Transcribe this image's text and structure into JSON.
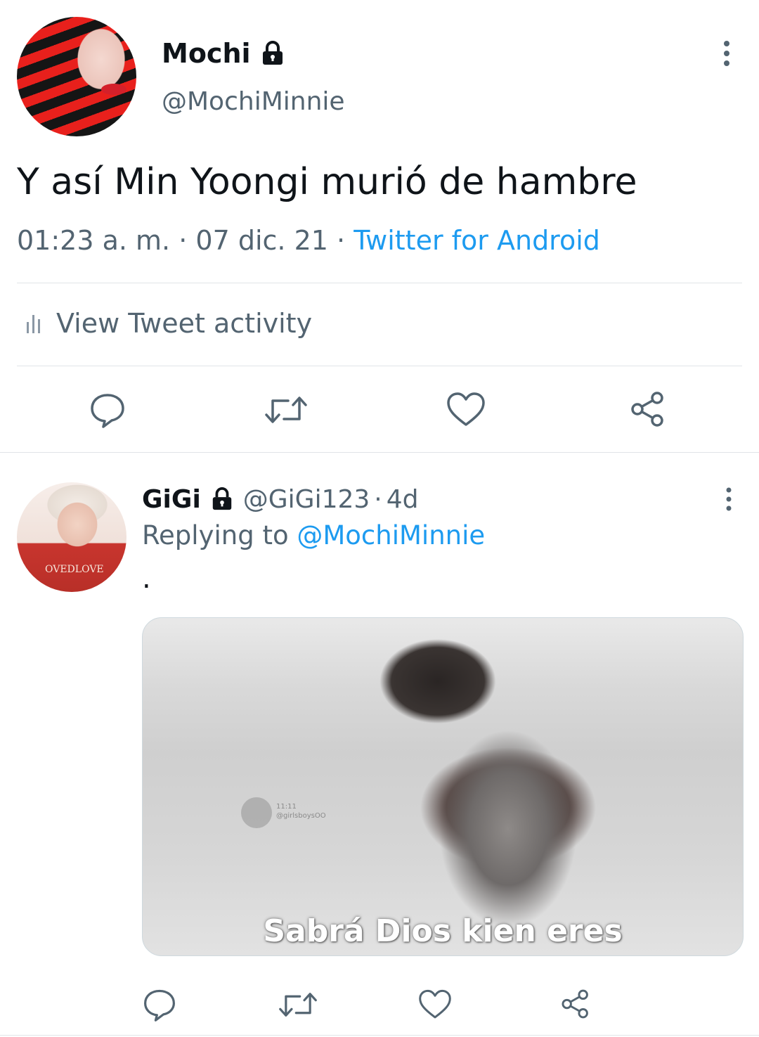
{
  "tweet": {
    "author_name": "Mochi",
    "author_handle": "@MochiMinnie",
    "text": "Y así Min Yoongi murió de hambre",
    "time": "01:23 a. m.",
    "date": "07 dic. 21",
    "source": "Twitter for Android",
    "activity_label": "View Tweet activity",
    "protected": true
  },
  "reply": {
    "author_name": "GiGi",
    "author_handle": "@GiGi123",
    "age": "4d",
    "replying_prefix": "Replying to",
    "replying_to": "@MochiMinnie",
    "text": ".",
    "media": {
      "caption": "Sabrá Dios kien eres",
      "watermark_time": "11:11",
      "watermark_user": "@girlsboysOO"
    },
    "avatar_text": "OVEDLOVE",
    "protected": true
  },
  "separators": {
    "dot": "·"
  },
  "icons": {
    "more": "more-vertical-icon",
    "lock": "lock-icon",
    "activity": "bar-chart-icon",
    "reply": "reply-bubble-icon",
    "retweet": "retweet-icon",
    "like": "heart-icon",
    "share": "share-icon"
  },
  "colors": {
    "link": "#1d9bf0",
    "secondary": "#536471",
    "text": "#0f1419"
  }
}
